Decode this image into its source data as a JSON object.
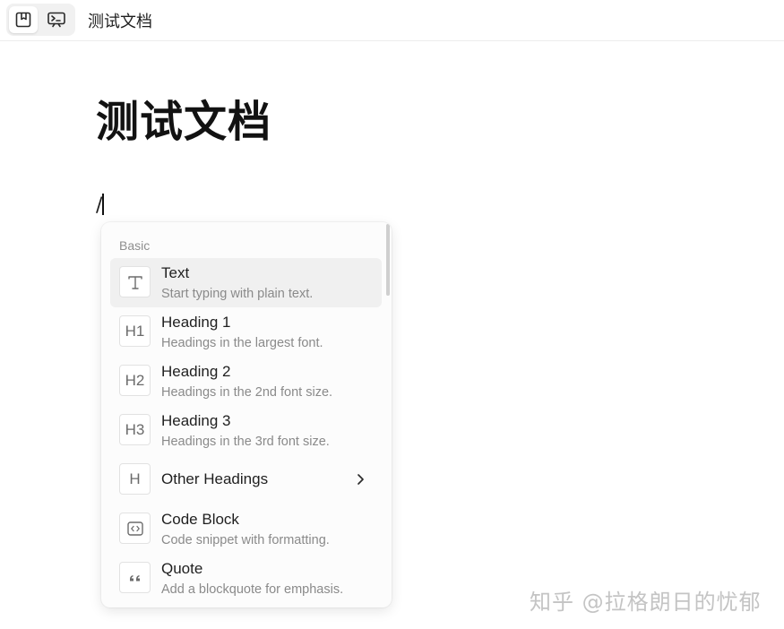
{
  "topbar": {
    "page_mode_icon": "page-mode-icon",
    "edgeless_mode_icon": "edgeless-mode-icon",
    "doc_title": "测试文档"
  },
  "document": {
    "title": "测试文档",
    "current_line": "/"
  },
  "slash_menu": {
    "group_label": "Basic",
    "items": [
      {
        "label": "Text",
        "description": "Start typing with plain text.",
        "icon": "text-icon",
        "icon_text": "T"
      },
      {
        "label": "Heading 1",
        "description": "Headings in the largest font.",
        "icon": "heading-1-icon",
        "icon_text": "H1"
      },
      {
        "label": "Heading 2",
        "description": "Headings in the 2nd font size.",
        "icon": "heading-2-icon",
        "icon_text": "H2"
      },
      {
        "label": "Heading 3",
        "description": "Headings in the 3rd font size.",
        "icon": "heading-3-icon",
        "icon_text": "H3"
      },
      {
        "label": "Other Headings",
        "icon": "heading-icon",
        "icon_text": "H"
      },
      {
        "label": "Code Block",
        "description": "Code snippet with formatting.",
        "icon": "code-block-icon"
      },
      {
        "label": "Quote",
        "description": "Add a blockquote for emphasis.",
        "icon": "quote-icon"
      }
    ]
  },
  "watermark": "知乎 @拉格朗日的忧郁"
}
